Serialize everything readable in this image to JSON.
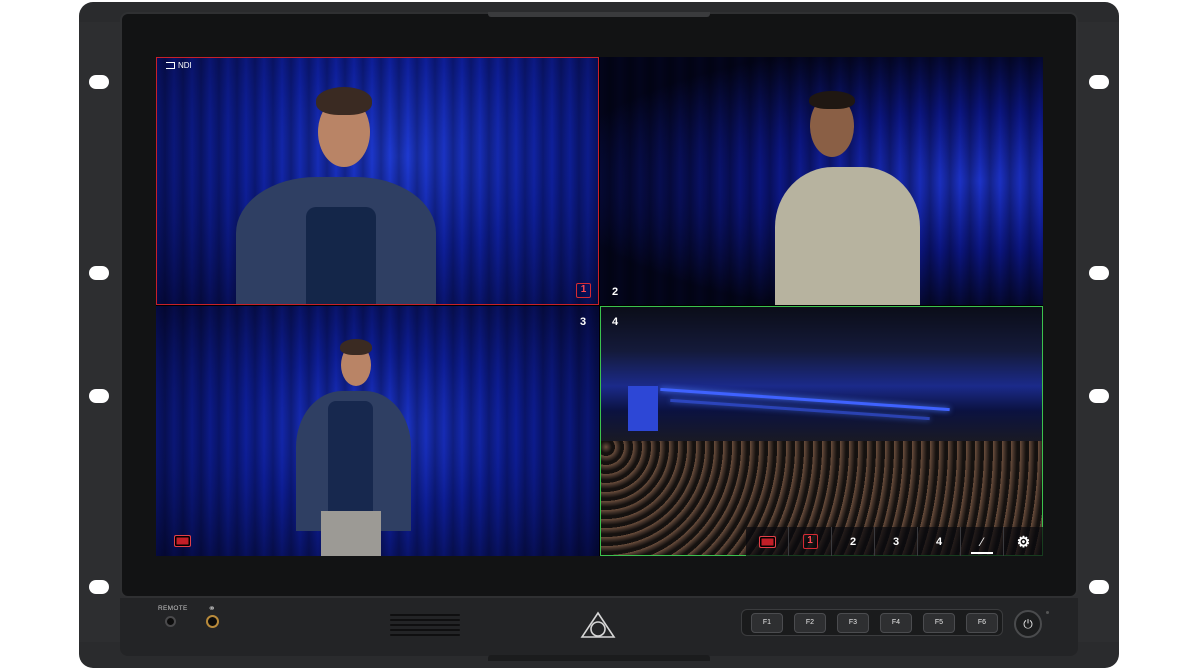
{
  "screen": {
    "tile1": {
      "input_label": "NDI",
      "cam_number": "1"
    },
    "tile2": {
      "cam_number": "2"
    },
    "tile3": {
      "cam_number": "3"
    },
    "tile4": {
      "cam_number": "4"
    }
  },
  "toolbar": {
    "buttons": [
      "1",
      "2",
      "3",
      "4"
    ],
    "record_icon": "record-icon",
    "cut_icon": "cut-icon",
    "settings_icon": "gear-icon"
  },
  "front_panel": {
    "remote_label": "REMOTE",
    "function_keys": [
      "F1",
      "F2",
      "F3",
      "F4",
      "F5",
      "F6"
    ],
    "power_icon": "power-icon"
  },
  "colors": {
    "program": "#c8202a",
    "preview": "#3bc24e",
    "background_blue": "#0e1f9a"
  }
}
